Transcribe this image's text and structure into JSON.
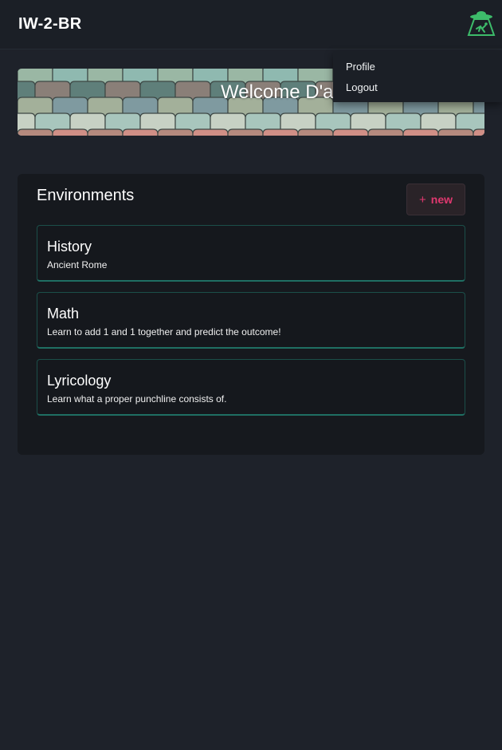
{
  "header": {
    "brand": "IW-2-BR",
    "logo_icon": "ufo-abduction-icon"
  },
  "user_menu": {
    "items": [
      {
        "label": "Profile"
      },
      {
        "label": "Logout"
      }
    ]
  },
  "banner": {
    "welcome_text": "Welcome D'a"
  },
  "environments": {
    "title": "Environments",
    "new_button": {
      "icon": "+",
      "label": "new"
    },
    "items": [
      {
        "title": "History",
        "description": "Ancient Rome"
      },
      {
        "title": "Math",
        "description": "Learn to add 1 and 1 together and predict the outcome!"
      },
      {
        "title": "Lyricology",
        "description": "Learn what a proper punchline consists of."
      }
    ]
  },
  "colors": {
    "background": "#1e222a",
    "panel": "#16191e",
    "accent_teal": "#1f6f63",
    "accent_pink": "#e0386f",
    "logo_green": "#3dbb6a"
  }
}
